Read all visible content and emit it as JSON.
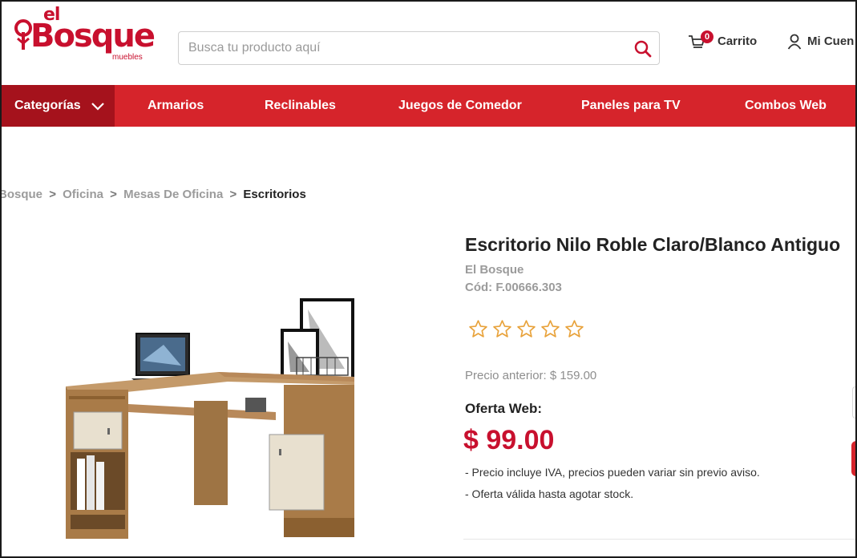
{
  "header": {
    "logo_top": "el",
    "logo_main": "Bosque",
    "logo_sub": "muebles",
    "search_placeholder": "Busca tu producto aquí",
    "cart_count": "0",
    "cart_label": "Carrito",
    "account_label": "Mi Cuen"
  },
  "nav": {
    "categories_label": "Categorías",
    "items": [
      {
        "label": "Armarios"
      },
      {
        "label": "Reclinables"
      },
      {
        "label": "Juegos de Comedor"
      },
      {
        "label": "Paneles para TV"
      },
      {
        "label": "Combos Web"
      }
    ]
  },
  "breadcrumb": {
    "items": [
      "Bosque",
      "Oficina",
      "Mesas De Oficina"
    ],
    "current": "Escritorios",
    "separator": ">"
  },
  "product": {
    "title": "Escritorio Nilo Roble Claro/Blanco Antiguo",
    "brand": "El Bosque",
    "code": "Cód: F.00666.303",
    "rating": 0,
    "rating_max": 5,
    "previous_price": "Precio anterior: $ 159.00",
    "offer_label": "Oferta Web:",
    "price": "$ 99.00",
    "note_1": "- Precio incluye IVA, precios pueden variar sin previo aviso.",
    "note_2": "- Oferta válida hasta agotar stock."
  },
  "colors": {
    "brand_red": "#c8102e",
    "nav_red": "#d6242b",
    "nav_dark": "#a5121c",
    "star_orange": "#e8a23a"
  },
  "icons": {
    "search": "search-icon",
    "cart": "cart-icon",
    "account": "user-icon",
    "chevron": "chevron-down-icon",
    "star": "star-outline-icon"
  }
}
